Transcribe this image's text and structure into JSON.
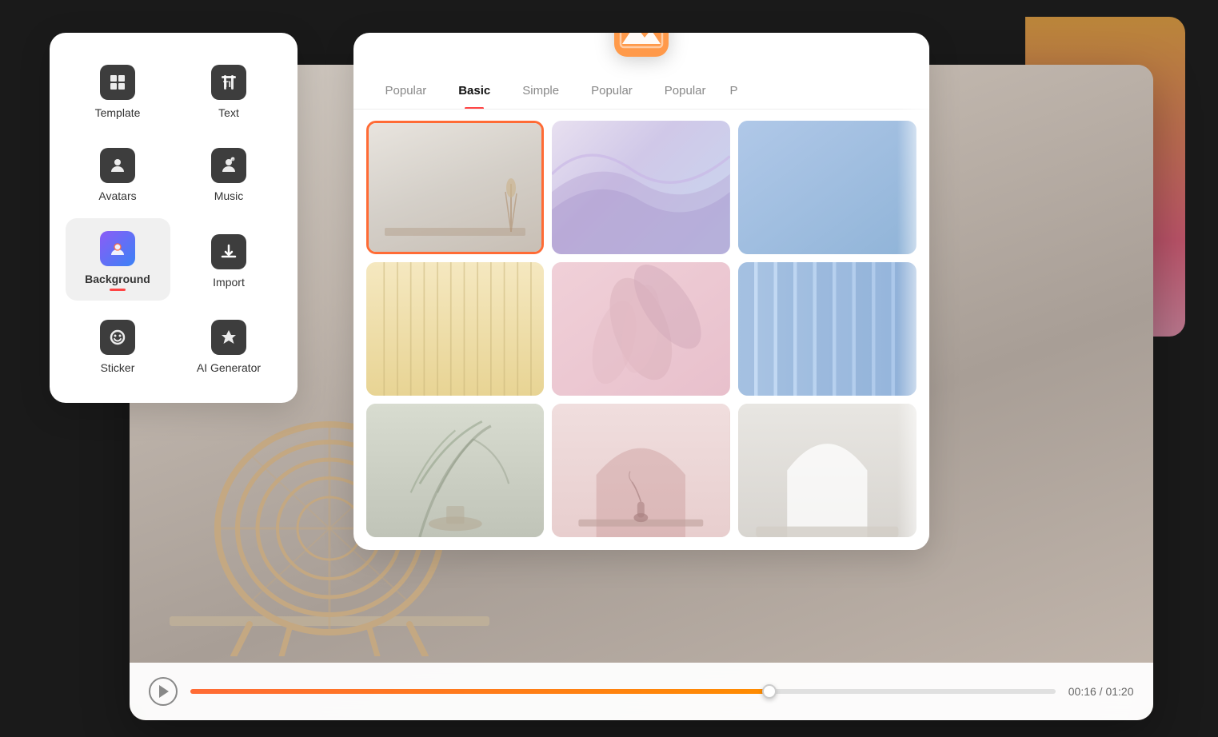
{
  "sidebar": {
    "items": [
      {
        "id": "template",
        "label": "Template",
        "icon": "⊞",
        "active": false
      },
      {
        "id": "text",
        "label": "Text",
        "icon": "TI",
        "active": false
      },
      {
        "id": "avatars",
        "label": "Avatars",
        "icon": "👤",
        "active": false
      },
      {
        "id": "music",
        "label": "Music",
        "icon": "🎵",
        "active": false
      },
      {
        "id": "background",
        "label": "Background",
        "icon": "🖼",
        "active": true
      },
      {
        "id": "import",
        "label": "Import",
        "icon": "⬇",
        "active": false
      },
      {
        "id": "sticker",
        "label": "Sticker",
        "icon": "😊",
        "active": false
      },
      {
        "id": "ai-generator",
        "label": "AI Generator",
        "icon": "△",
        "active": false
      }
    ]
  },
  "background_panel": {
    "tabs": [
      {
        "id": "popular1",
        "label": "Popular",
        "active": false
      },
      {
        "id": "basic",
        "label": "Basic",
        "active": true
      },
      {
        "id": "simple",
        "label": "Simple",
        "active": false
      },
      {
        "id": "popular2",
        "label": "Popular",
        "active": false
      },
      {
        "id": "popular3",
        "label": "Popular",
        "active": false
      }
    ],
    "thumbnails": [
      {
        "id": 1,
        "selected": true,
        "style": "minimal-room"
      },
      {
        "id": 2,
        "selected": false,
        "style": "purple-wave"
      },
      {
        "id": 3,
        "selected": false,
        "style": "blue-gradient"
      },
      {
        "id": 4,
        "selected": false,
        "style": "warm-ribbed"
      },
      {
        "id": 5,
        "selected": false,
        "style": "pink-feather"
      },
      {
        "id": 6,
        "selected": false,
        "style": "blue-vertical"
      },
      {
        "id": 7,
        "selected": false,
        "style": "palm-shadow"
      },
      {
        "id": 8,
        "selected": false,
        "style": "pink-arch"
      },
      {
        "id": 9,
        "selected": false,
        "style": "white-arch"
      }
    ]
  },
  "video_controls": {
    "current_time": "00:16",
    "total_time": "01:20",
    "time_display": "00:16 / 01:20",
    "progress_percent": 67
  }
}
